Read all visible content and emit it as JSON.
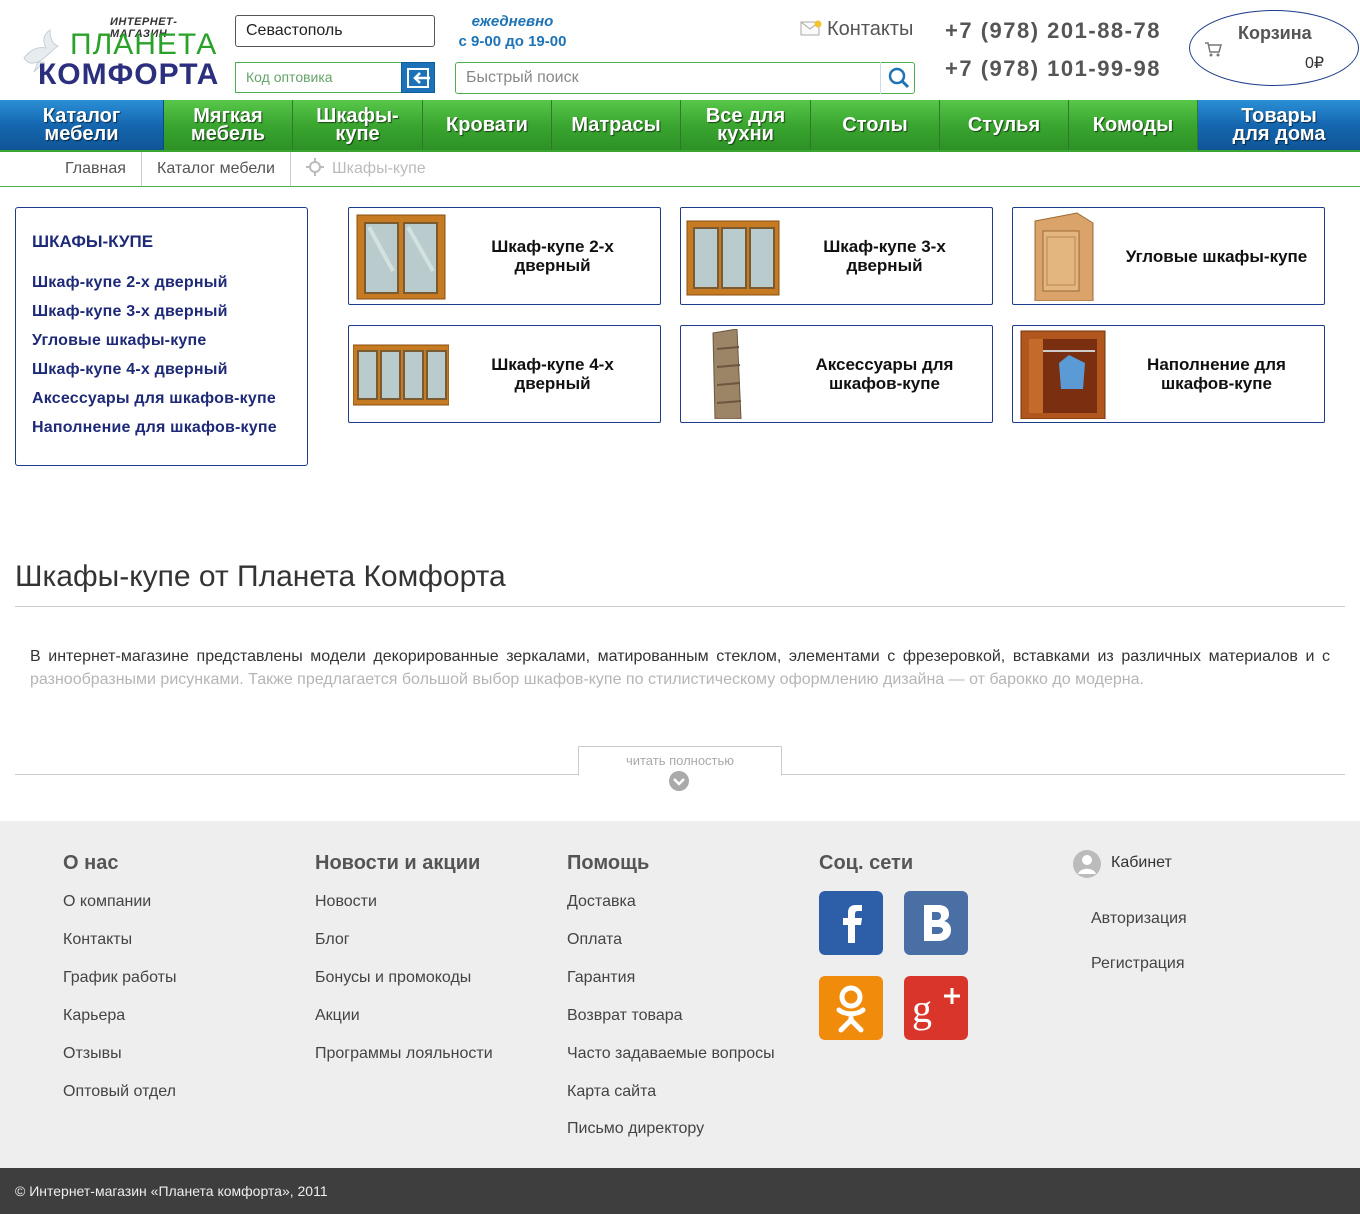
{
  "header": {
    "logo_top": "ИНТЕРНЕТ-МАГАЗИН",
    "logo_mid": "ПЛАНЕТА",
    "logo_bot": "КОМФОРТА",
    "city_value": "Севастополь",
    "wholesale_placeholder": "Код оптовика",
    "hours_line1": "ежедневно",
    "hours_line2": "с 9-00 до 19-00",
    "search_placeholder": "Быстрый поиск",
    "contacts_label": "Контакты",
    "phone1": "+7 (978) 201-88-78",
    "phone2": "+7 (978) 101-99-98",
    "cart_title": "Корзина",
    "cart_sum": "0₽"
  },
  "nav": {
    "items": [
      {
        "label": "Каталог мебели"
      },
      {
        "label": "Мягкая мебель"
      },
      {
        "label": "Шкафы-купе"
      },
      {
        "label": "Кровати"
      },
      {
        "label": "Матрасы"
      },
      {
        "label": "Все для кухни"
      },
      {
        "label": "Столы"
      },
      {
        "label": "Стулья"
      },
      {
        "label": "Комоды"
      },
      {
        "label": "Товары для дома"
      }
    ]
  },
  "breadcrumb": {
    "home": "Главная",
    "catalog": "Каталог мебели",
    "current": "Шкафы-купе"
  },
  "sidebar": {
    "title": "ШКАФЫ-КУПЕ",
    "links": [
      "Шкаф-купе 2-х дверный",
      "Шкаф-купе 3-х дверный",
      "Угловые шкафы-купе",
      "Шкаф-купе 4-х дверный",
      "Аксессуары для шкафов-купе",
      "Наполнение для шкафов-купе"
    ]
  },
  "tiles": [
    {
      "label": "Шкаф-купе 2-х дверный",
      "icon": "wardrobe-2-door-icon"
    },
    {
      "label": "Шкаф-купе 3-х дверный",
      "icon": "wardrobe-3-door-icon"
    },
    {
      "label": "Угловые шкафы-купе",
      "icon": "corner-wardrobe-icon"
    },
    {
      "label": "Шкаф-купе 4-х дверный",
      "icon": "wardrobe-4-door-icon"
    },
    {
      "label": "Аксессуары для шкафов-купе",
      "icon": "shelf-accessory-icon"
    },
    {
      "label": "Наполнение для шкафов-купе",
      "icon": "wardrobe-interior-icon"
    }
  ],
  "article": {
    "title": "Шкафы-купе от Планета Комфорта",
    "text_visible": "В интернет-магазине представлены модели декорированные зеркалами, матированным стеклом, элементами с фрезеровкой, вставками из различных материалов и с ",
    "text_faded": "разнообразными рисунками. Также предлагается большой выбор шкафов-купе по стилистическому оформлению дизайна — от барокко до модерна.",
    "read_more": "читать полностью"
  },
  "footer": {
    "about": {
      "title": "О нас",
      "links": [
        "О компании",
        "Контакты",
        "График работы",
        "Карьера",
        "Отзывы",
        "Оптовый отдел"
      ]
    },
    "news": {
      "title": "Новости и акции",
      "links": [
        "Новости",
        "Блог",
        "Бонусы и промокоды",
        "Акции",
        "Программы лояльности"
      ]
    },
    "help": {
      "title": "Помощь",
      "links": [
        "Доставка",
        "Оплата",
        "Гарантия",
        "Возврат товара",
        "Часто задаваемые вопросы",
        "Карта сайта",
        "Письмо директору"
      ]
    },
    "social": {
      "title": "Соц. сети",
      "colors": {
        "facebook": "#2d5ea8",
        "vk": "#4a6fa5",
        "ok": "#f08b0c",
        "gplus": "#d9352a"
      }
    },
    "cabinet": {
      "title": "Кабинет",
      "login": "Авторизация",
      "register": "Регистрация"
    },
    "copyright": "© Интернет-магазин «Планета комфорта», 2011"
  }
}
